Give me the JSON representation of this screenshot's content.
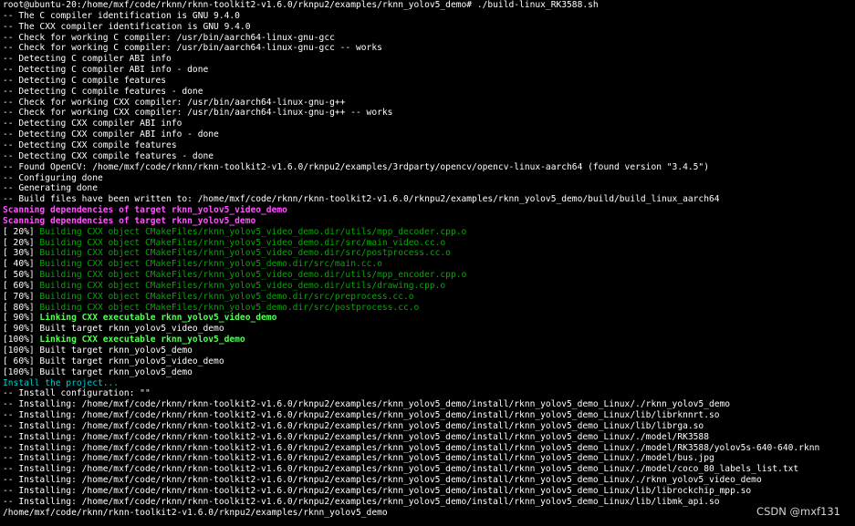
{
  "terminal": {
    "prompt_line": "root@ubuntu-20:/home/mxf/code/rknn/rknn-toolkit2-v1.6.0/rknpu2/examples/rknn_yolov5_demo# ./build-linux_RK3588.sh",
    "cmake_output": [
      "-- The C compiler identification is GNU 9.4.0",
      "-- The CXX compiler identification is GNU 9.4.0",
      "-- Check for working C compiler: /usr/bin/aarch64-linux-gnu-gcc",
      "-- Check for working C compiler: /usr/bin/aarch64-linux-gnu-gcc -- works",
      "-- Detecting C compiler ABI info",
      "-- Detecting C compiler ABI info - done",
      "-- Detecting C compile features",
      "-- Detecting C compile features - done",
      "-- Check for working CXX compiler: /usr/bin/aarch64-linux-gnu-g++",
      "-- Check for working CXX compiler: /usr/bin/aarch64-linux-gnu-g++ -- works",
      "-- Detecting CXX compiler ABI info",
      "-- Detecting CXX compiler ABI info - done",
      "-- Detecting CXX compile features",
      "-- Detecting CXX compile features - done",
      "-- Found OpenCV: /home/mxf/code/rknn/rknn-toolkit2-v1.6.0/rknpu2/examples/3rdparty/opencv/opencv-linux-aarch64 (found version \"3.4.5\")",
      "-- Configuring done",
      "-- Generating done",
      "-- Build files have been written to: /home/mxf/code/rknn/rknn-toolkit2-v1.6.0/rknpu2/examples/rknn_yolov5_demo/build/build_linux_aarch64"
    ],
    "scanning": [
      "Scanning dependencies of target rknn_yolov5_video_demo",
      "Scanning dependencies of target rknn_yolov5_demo"
    ],
    "build_steps": [
      {
        "pct": "[ 20%]",
        "text": " Building CXX object CMakeFiles/rknn_yolov5_video_demo.dir/utils/mpp_decoder.cpp.o"
      },
      {
        "pct": "[ 20%]",
        "text": " Building CXX object CMakeFiles/rknn_yolov5_video_demo.dir/src/main_video.cc.o"
      },
      {
        "pct": "[ 30%]",
        "text": " Building CXX object CMakeFiles/rknn_yolov5_video_demo.dir/src/postprocess.cc.o"
      },
      {
        "pct": "[ 40%]",
        "text": " Building CXX object CMakeFiles/rknn_yolov5_demo.dir/src/main.cc.o"
      },
      {
        "pct": "[ 50%]",
        "text": " Building CXX object CMakeFiles/rknn_yolov5_video_demo.dir/utils/mpp_encoder.cpp.o"
      },
      {
        "pct": "[ 60%]",
        "text": " Building CXX object CMakeFiles/rknn_yolov5_video_demo.dir/utils/drawing.cpp.o"
      },
      {
        "pct": "[ 70%]",
        "text": " Building CXX object CMakeFiles/rknn_yolov5_demo.dir/src/preprocess.cc.o"
      },
      {
        "pct": "[ 80%]",
        "text": " Building CXX object CMakeFiles/rknn_yolov5_demo.dir/src/postprocess.cc.o"
      }
    ],
    "link_video": {
      "pct": "[ 90%]",
      "text": " Linking CXX executable rknn_yolov5_video_demo"
    },
    "built_video_90": "[ 90%] Built target rknn_yolov5_video_demo",
    "link_demo": {
      "pct": "[100%]",
      "text": " Linking CXX executable rknn_yolov5_demo"
    },
    "built_lines": [
      "[100%] Built target rknn_yolov5_demo",
      "[ 60%] Built target rknn_yolov5_video_demo",
      "[100%] Built target rknn_yolov5_demo"
    ],
    "install_header": "Install the project...",
    "install_lines": [
      "-- Install configuration: \"\"",
      "-- Installing: /home/mxf/code/rknn/rknn-toolkit2-v1.6.0/rknpu2/examples/rknn_yolov5_demo/install/rknn_yolov5_demo_Linux/./rknn_yolov5_demo",
      "-- Installing: /home/mxf/code/rknn/rknn-toolkit2-v1.6.0/rknpu2/examples/rknn_yolov5_demo/install/rknn_yolov5_demo_Linux/lib/librknnrt.so",
      "-- Installing: /home/mxf/code/rknn/rknn-toolkit2-v1.6.0/rknpu2/examples/rknn_yolov5_demo/install/rknn_yolov5_demo_Linux/lib/librga.so",
      "-- Installing: /home/mxf/code/rknn/rknn-toolkit2-v1.6.0/rknpu2/examples/rknn_yolov5_demo/install/rknn_yolov5_demo_Linux/./model/RK3588",
      "-- Installing: /home/mxf/code/rknn/rknn-toolkit2-v1.6.0/rknpu2/examples/rknn_yolov5_demo/install/rknn_yolov5_demo_Linux/./model/RK3588/yolov5s-640-640.rknn",
      "-- Installing: /home/mxf/code/rknn/rknn-toolkit2-v1.6.0/rknpu2/examples/rknn_yolov5_demo/install/rknn_yolov5_demo_Linux/./model/bus.jpg",
      "-- Installing: /home/mxf/code/rknn/rknn-toolkit2-v1.6.0/rknpu2/examples/rknn_yolov5_demo/install/rknn_yolov5_demo_Linux/./model/coco_80_labels_list.txt",
      "-- Installing: /home/mxf/code/rknn/rknn-toolkit2-v1.6.0/rknpu2/examples/rknn_yolov5_demo/install/rknn_yolov5_demo_Linux/./rknn_yolov5_video_demo",
      "-- Installing: /home/mxf/code/rknn/rknn-toolkit2-v1.6.0/rknpu2/examples/rknn_yolov5_demo/install/rknn_yolov5_demo_Linux/lib/librockchip_mpp.so",
      "-- Installing: /home/mxf/code/rknn/rknn-toolkit2-v1.6.0/rknpu2/examples/rknn_yolov5_demo/install/rknn_yolov5_demo_Linux/lib/libmk_api.so"
    ],
    "final_prompt": "/home/mxf/code/rknn/rknn-toolkit2-v1.6.0/rknpu2/examples/rknn_yolov5_demo"
  },
  "watermark": "CSDN @mxf131",
  "colors": {
    "background": "#000000",
    "text": "#ffffff",
    "scanning": "#ff55ff",
    "building": "#00aa00",
    "linking": "#55ff55",
    "install_header": "#00cdcd"
  }
}
